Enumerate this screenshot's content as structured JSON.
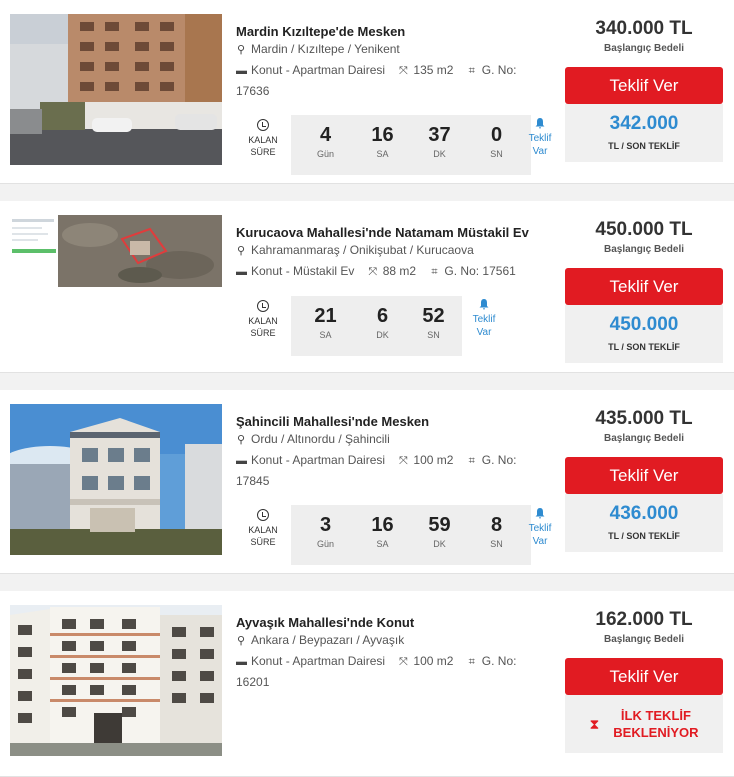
{
  "common": {
    "kalan": "KALAN",
    "sure": "SÜRE",
    "teklif_ver": "Teklif Ver",
    "bell_line1": "Teklif",
    "bell_line2": "Var",
    "baslangic": "Başlangıç Bedeli",
    "son_teklif": "TL / SON TEKLİF",
    "ilk_teklif_line1": "İLK TEKLİF",
    "ilk_teklif_line2": "BEKLENİYOR",
    "icons": {
      "location": "map-marker-icon",
      "building": "building-icon",
      "area": "area-arrows-icon",
      "parcel": "parcel-icon",
      "clock": "clock-icon",
      "bell": "bell-icon",
      "hourglass": "hourglass-icon"
    },
    "colors": {
      "accent_red": "#e11b22",
      "accent_blue": "#2e8bd0"
    }
  },
  "listings": [
    {
      "title": "Mardin Kızıltepe'de Mesken",
      "location": "Mardin / Kızıltepe / Yenikent",
      "type": "Konut - Apartman Dairesi",
      "area": "135 m2",
      "parcel": "G. No: 17636",
      "timer": [
        {
          "value": "4",
          "unit": "Gün"
        },
        {
          "value": "16",
          "unit": "SA"
        },
        {
          "value": "37",
          "unit": "DK"
        },
        {
          "value": "0",
          "unit": "SN"
        }
      ],
      "start_price": "340.000 TL",
      "last_bid": "342.000"
    },
    {
      "title": "Kurucaova Mahallesi'nde Natamam Müstakil Ev",
      "location": "Kahramanmaraş / Onikişubat / Kurucaova",
      "type": "Konut - Müstakil Ev",
      "area": "88 m2",
      "parcel": "G. No: 17561",
      "timer": [
        {
          "value": "21",
          "unit": "SA"
        },
        {
          "value": "6",
          "unit": "DK"
        },
        {
          "value": "52",
          "unit": "SN"
        }
      ],
      "start_price": "450.000 TL",
      "last_bid": "450.000"
    },
    {
      "title": "Şahincili Mahallesi'nde Mesken",
      "location": "Ordu / Altınordu / Şahincili",
      "type": "Konut - Apartman Dairesi",
      "area": "100 m2",
      "parcel": "G. No: 17845",
      "timer": [
        {
          "value": "3",
          "unit": "Gün"
        },
        {
          "value": "16",
          "unit": "SA"
        },
        {
          "value": "59",
          "unit": "DK"
        },
        {
          "value": "8",
          "unit": "SN"
        }
      ],
      "start_price": "435.000 TL",
      "last_bid": "436.000"
    },
    {
      "title": "Ayvaşık Mahallesi'nde Konut",
      "location": "Ankara / Beypazarı / Ayvaşık",
      "type": "Konut - Apartman Dairesi",
      "area": "100 m2",
      "parcel": "G. No: 16201",
      "start_price": "162.000 TL"
    }
  ]
}
